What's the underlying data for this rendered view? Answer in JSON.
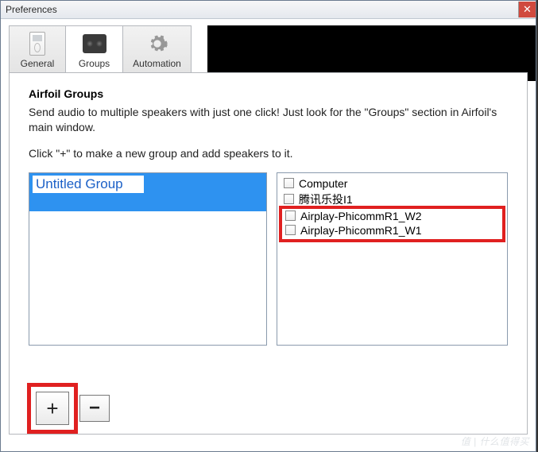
{
  "window": {
    "title": "Preferences"
  },
  "tabs": {
    "general": "General",
    "groups": "Groups",
    "automation": "Automation",
    "active": "groups"
  },
  "groups_panel": {
    "heading": "Airfoil Groups",
    "description": "Send audio to multiple speakers with just one click! Just look for the \"Groups\" section in Airfoil's main window.",
    "hint": "Click \"+\" to make a new group and add speakers to it.",
    "group_name_value": "Untitled Group",
    "speakers": [
      {
        "label": "Computer",
        "checked": false
      },
      {
        "label": "腾讯乐投I1",
        "checked": false
      },
      {
        "label": "Airplay-PhicommR1_W2",
        "checked": false
      },
      {
        "label": "Airplay-PhicommR1_W1",
        "checked": false
      }
    ],
    "add_label": "+",
    "remove_label": "−"
  },
  "watermark": "值 | 什么值得买"
}
